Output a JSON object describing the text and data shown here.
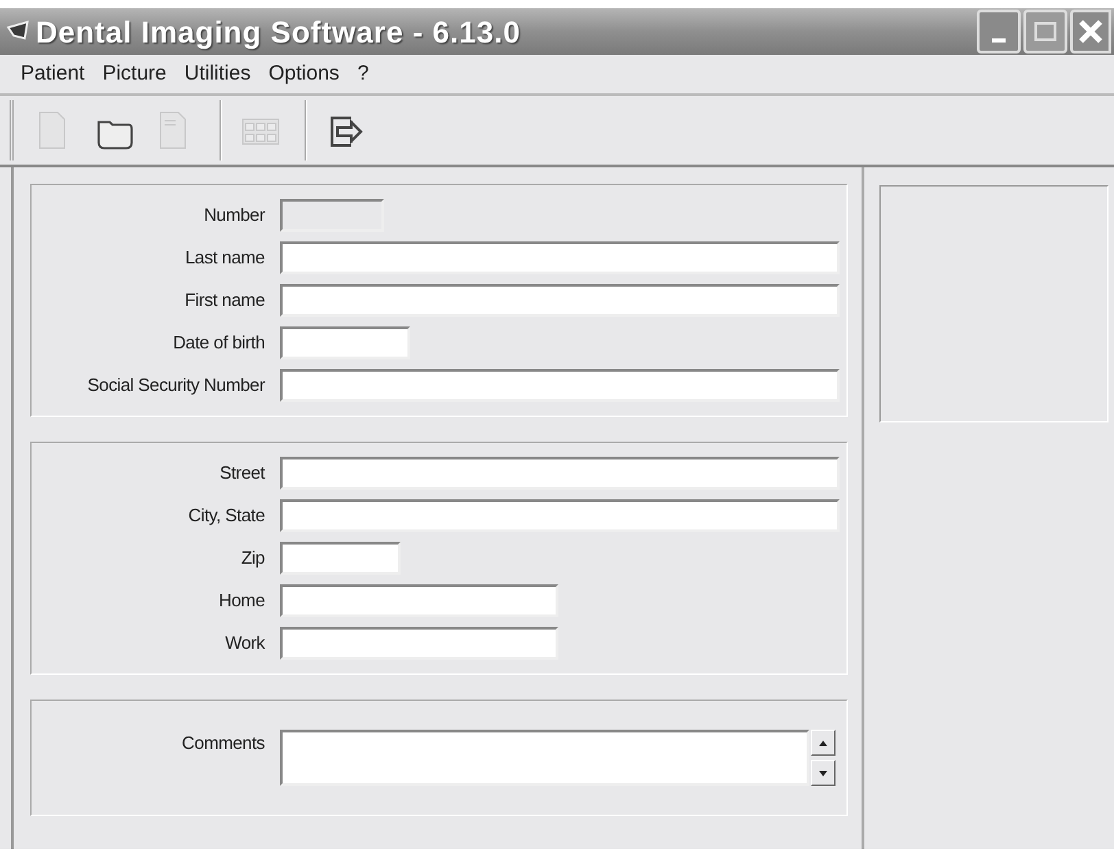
{
  "window": {
    "title": "Dental Imaging Software - 6.13.0"
  },
  "menu": [
    "Patient",
    "Picture",
    "Utilities",
    "Options",
    "?"
  ],
  "toolbar": [
    {
      "kind": "document",
      "disabled": true
    },
    {
      "kind": "folder",
      "disabled": false
    },
    {
      "kind": "lined-document",
      "disabled": true
    },
    {
      "kind": "separator"
    },
    {
      "kind": "grid",
      "disabled": true
    },
    {
      "kind": "separator"
    },
    {
      "kind": "exit",
      "disabled": false
    }
  ],
  "sections": [
    {
      "fields": [
        {
          "label": "Number",
          "kind": "text",
          "disabled": true
        },
        {
          "label": "Last name",
          "kind": "text",
          "disabled": false
        },
        {
          "label": "First name",
          "kind": "text",
          "disabled": false
        },
        {
          "label": "Date of birth",
          "kind": "text",
          "disabled": false
        },
        {
          "label": "Social Security Number",
          "kind": "text",
          "disabled": false
        }
      ]
    },
    {
      "fields": [
        {
          "label": "Street",
          "kind": "text",
          "disabled": false
        },
        {
          "label": "City, State",
          "kind": "text",
          "disabled": false
        },
        {
          "label": "Zip",
          "kind": "text",
          "disabled": false
        },
        {
          "label": "Home",
          "kind": "text",
          "disabled": false
        },
        {
          "label": "Work",
          "kind": "text",
          "disabled": false
        }
      ]
    },
    {
      "fields": [
        {
          "label": "Comments",
          "kind": "memo",
          "disabled": false
        }
      ]
    }
  ]
}
